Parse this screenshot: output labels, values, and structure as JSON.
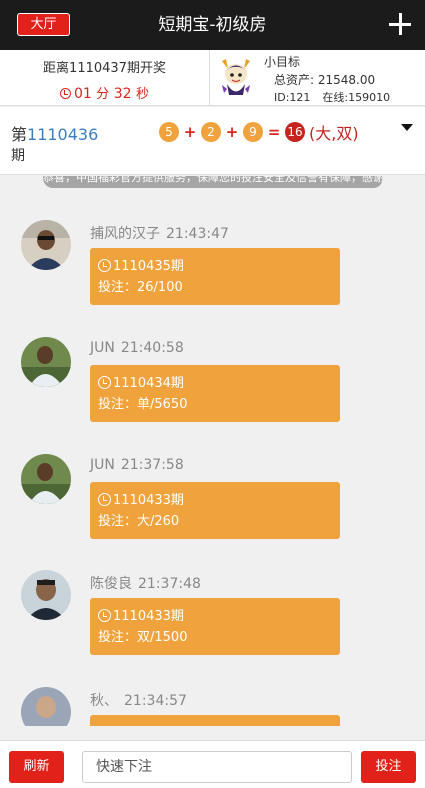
{
  "header": {
    "lobby_label": "大厅",
    "title": "短期宝-初级房",
    "menu_icon": "plus-icon"
  },
  "info": {
    "period_label": "距离1110437期开奖",
    "countdown_min": "01",
    "countdown_min_unit": "分",
    "countdown_sec": "32",
    "countdown_sec_unit": "秒",
    "nickname": "小目标",
    "assets": "总资产: 21548.00",
    "user_id": "ID:121",
    "online": "在线:159010"
  },
  "result": {
    "prefix": "第",
    "issue": "1110436",
    "suffix": "期",
    "balls": [
      "5",
      "2",
      "9"
    ],
    "plus": "+",
    "equals": "=",
    "sum": "16",
    "verdict": "(大,双)"
  },
  "notice": "恭喜，中国福彩官方提供服务，保障您的投注安全及信誉有保障，感谢",
  "messages": [
    {
      "user": "捕风的汉子",
      "time": "21:43:47",
      "period": "1110435期",
      "bet": "投注：26/100"
    },
    {
      "user": "JUN",
      "time": "21:40:58",
      "period": "1110434期",
      "bet": "投注：单/5650"
    },
    {
      "user": "JUN",
      "time": "21:37:58",
      "period": "1110433期",
      "bet": "投注：大/260"
    },
    {
      "user": "陈俊良",
      "time": "21:37:48",
      "period": "1110433期",
      "bet": "投注：双/1500"
    },
    {
      "user": "秋、",
      "time": "21:34:57",
      "period": "",
      "bet": ""
    }
  ],
  "footer": {
    "refresh_label": "刷新",
    "input_placeholder": "快速下注",
    "bet_label": "投注"
  },
  "colors": {
    "header_bg": "#1b1b1b",
    "accent_red": "#e3211b",
    "bubble_orange": "#f0a33c",
    "issue_blue": "#3d7ec3"
  }
}
